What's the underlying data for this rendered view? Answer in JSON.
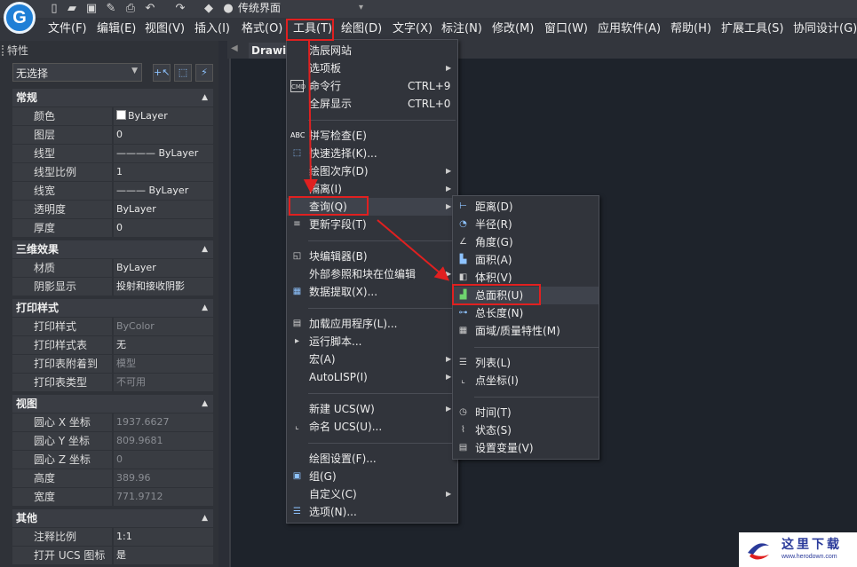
{
  "app": {
    "logo_letter": "G",
    "workspace": "传统界面"
  },
  "menubar": {
    "items": [
      "文件(F)",
      "编辑(E)",
      "视图(V)",
      "插入(I)",
      "格式(O)",
      "工具(T)",
      "绘图(D)",
      "文字(X)",
      "标注(N)",
      "修改(M)",
      "窗口(W)",
      "应用软件(A)",
      "帮助(H)",
      "扩展工具(S)",
      "协同设计(G)"
    ]
  },
  "properties": {
    "title": "特性",
    "selection": "无选择",
    "sections": {
      "general": "常规",
      "three_d": "三维效果",
      "plot": "打印样式",
      "view": "视图",
      "misc": "其他"
    },
    "general_rows": [
      {
        "k": "颜色",
        "v": "ByLayer"
      },
      {
        "k": "图层",
        "v": "0"
      },
      {
        "k": "线型",
        "v": "———— ByLayer"
      },
      {
        "k": "线型比例",
        "v": "1"
      },
      {
        "k": "线宽",
        "v": "——— ByLayer"
      },
      {
        "k": "透明度",
        "v": "ByLayer"
      },
      {
        "k": "厚度",
        "v": "0"
      }
    ],
    "three_d_rows": [
      {
        "k": "材质",
        "v": "ByLayer"
      },
      {
        "k": "阴影显示",
        "v": "投射和接收阴影"
      }
    ],
    "plot_rows": [
      {
        "k": "打印样式",
        "v": "ByColor"
      },
      {
        "k": "打印样式表",
        "v": "无"
      },
      {
        "k": "打印表附着到",
        "v": "模型"
      },
      {
        "k": "打印表类型",
        "v": "不可用"
      }
    ],
    "view_rows": [
      {
        "k": "圆心 X 坐标",
        "v": "1937.6627"
      },
      {
        "k": "圆心 Y 坐标",
        "v": "809.9681"
      },
      {
        "k": "圆心 Z 坐标",
        "v": "0"
      },
      {
        "k": "高度",
        "v": "389.96"
      },
      {
        "k": "宽度",
        "v": "771.9712"
      }
    ],
    "misc_rows": [
      {
        "k": "注释比例",
        "v": "1:1"
      },
      {
        "k": "打开 UCS 图标",
        "v": "是"
      }
    ]
  },
  "drawing_tab": "Drawing",
  "tools_menu": [
    {
      "label": "浩辰网站"
    },
    {
      "label": "选项板"
    },
    {
      "label": "命令行",
      "shortcut": "CTRL+9"
    },
    {
      "label": "全屏显示",
      "shortcut": "CTRL+0"
    },
    {
      "label": "拼写检查(E)"
    },
    {
      "label": "快速选择(K)..."
    },
    {
      "label": "绘图次序(D)"
    },
    {
      "label": "隔离(I)"
    },
    {
      "label": "查询(Q)"
    },
    {
      "label": "更新字段(T)"
    },
    {
      "label": "块编辑器(B)"
    },
    {
      "label": "外部参照和块在位编辑"
    },
    {
      "label": "数据提取(X)..."
    },
    {
      "label": "加载应用程序(L)..."
    },
    {
      "label": "运行脚本..."
    },
    {
      "label": "宏(A)"
    },
    {
      "label": "AutoLISP(I)"
    },
    {
      "label": "新建 UCS(W)"
    },
    {
      "label": "命名 UCS(U)..."
    },
    {
      "label": "绘图设置(F)..."
    },
    {
      "label": "组(G)"
    },
    {
      "label": "自定义(C)"
    },
    {
      "label": "选项(N)..."
    }
  ],
  "inquiry_menu": [
    {
      "label": "距离(D)"
    },
    {
      "label": "半径(R)"
    },
    {
      "label": "角度(G)"
    },
    {
      "label": "面积(A)"
    },
    {
      "label": "体积(V)"
    },
    {
      "label": "总面积(U)"
    },
    {
      "label": "总长度(N)"
    },
    {
      "label": "面域/质量特性(M)"
    },
    {
      "label": "列表(L)"
    },
    {
      "label": "点坐标(I)"
    },
    {
      "label": "时间(T)"
    },
    {
      "label": "状态(S)"
    },
    {
      "label": "设置变量(V)"
    }
  ],
  "watermark": {
    "text": "这里下载",
    "url": "www.herodown.com"
  },
  "colors": {
    "highlight_box": "#e02020",
    "accent": "#1f7fd6"
  }
}
